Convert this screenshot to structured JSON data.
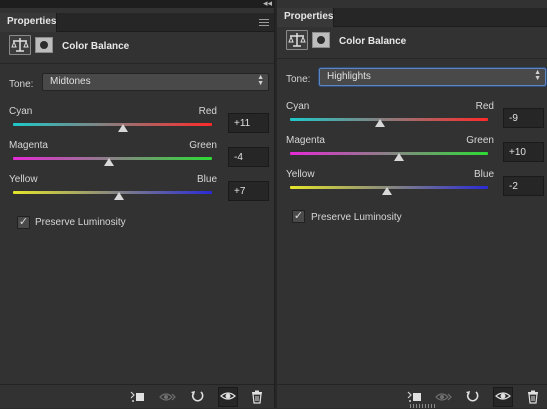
{
  "panels": [
    {
      "tab": "Properties",
      "title": "Color Balance",
      "tone_label": "Tone:",
      "tone_value": "Midtones",
      "sliders": [
        {
          "left": "Cyan",
          "right": "Red",
          "value": "+11",
          "level": 0.555,
          "colors": [
            "#1ec9c9",
            "#ff2a2a"
          ]
        },
        {
          "left": "Magenta",
          "right": "Green",
          "value": "-4",
          "level": 0.48,
          "colors": [
            "#e52ad6",
            "#2ddc35"
          ]
        },
        {
          "left": "Yellow",
          "right": "Blue",
          "value": "+7",
          "level": 0.535,
          "colors": [
            "#e6e62a",
            "#2a2ad6"
          ]
        }
      ],
      "preserve_label": "Preserve Luminosity",
      "preserve_checked": true,
      "footer_icons": [
        "clip-to-layer-icon",
        "view-previous-icon",
        "reset-icon",
        "visibility-icon",
        "trash-icon"
      ]
    },
    {
      "tab": "Properties",
      "title": "Color Balance",
      "tone_label": "Tone:",
      "tone_value": "Highlights",
      "sliders": [
        {
          "left": "Cyan",
          "right": "Red",
          "value": "-9",
          "level": 0.455,
          "colors": [
            "#1ec9c9",
            "#ff2a2a"
          ]
        },
        {
          "left": "Magenta",
          "right": "Green",
          "value": "+10",
          "level": 0.55,
          "colors": [
            "#e52ad6",
            "#2ddc35"
          ]
        },
        {
          "left": "Yellow",
          "right": "Blue",
          "value": "-2",
          "level": 0.49,
          "colors": [
            "#e6e62a",
            "#2a2ad6"
          ]
        }
      ],
      "preserve_label": "Preserve Luminosity",
      "preserve_checked": true,
      "footer_icons": [
        "clip-to-layer-icon",
        "view-previous-icon",
        "reset-icon",
        "visibility-icon",
        "trash-icon"
      ]
    }
  ]
}
